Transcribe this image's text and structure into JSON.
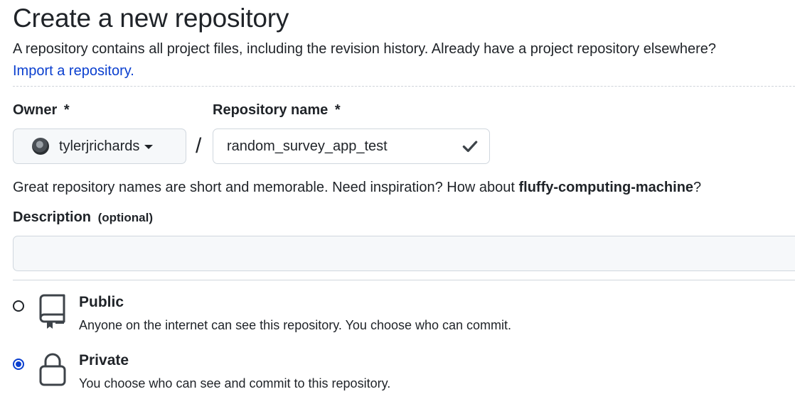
{
  "page": {
    "title": "Create a new repository",
    "intro": "A repository contains all project files, including the revision history. Already have a project repository elsewhere?",
    "import_link": "Import a repository."
  },
  "owner": {
    "label": "Owner",
    "required_mark": "*",
    "value": "tylerjrichards"
  },
  "repository_name": {
    "label": "Repository name",
    "required_mark": "*",
    "value": "random_survey_app_test",
    "valid": true
  },
  "name_hint": {
    "text": "Great repository names are short and memorable. Need inspiration? How about ",
    "suggestion": "fluffy-computing-machine",
    "suffix": "?"
  },
  "description": {
    "label": "Description",
    "optional": "(optional)",
    "value": ""
  },
  "visibility": {
    "options": [
      {
        "id": "public",
        "title": "Public",
        "description": "Anyone on the internet can see this repository. You choose who can commit.",
        "icon": "repo-book-icon",
        "selected": false
      },
      {
        "id": "private",
        "title": "Private",
        "description": "You choose who can see and commit to this repository.",
        "icon": "lock-icon",
        "selected": true
      }
    ]
  },
  "colors": {
    "link": "#0a3fcf",
    "radio_selected": "#0a3fcf",
    "border": "#d0d7de",
    "input_bg": "#f6f8fa"
  }
}
